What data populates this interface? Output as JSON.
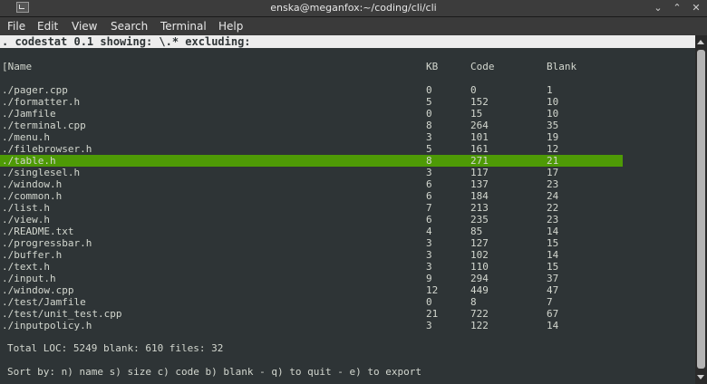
{
  "window": {
    "title": "enska@meganfox:~/coding/cli/cli",
    "minimize_glyph": "⌄",
    "maximize_glyph": "⌃",
    "close_glyph": "✕"
  },
  "menu": [
    "File",
    "Edit",
    "View",
    "Search",
    "Terminal",
    "Help"
  ],
  "status_line": ". codestat 0.1 showing: \\.* excluding:",
  "table": {
    "headers": {
      "name": "[Name",
      "kb": "KB",
      "code": "Code",
      "blank": "Blank"
    },
    "selected_index": 6,
    "rows": [
      {
        "name": "./pager.cpp",
        "kb": "0",
        "code": "0",
        "blank": "1"
      },
      {
        "name": "./formatter.h",
        "kb": "5",
        "code": "152",
        "blank": "10"
      },
      {
        "name": "./Jamfile",
        "kb": "0",
        "code": "15",
        "blank": "10"
      },
      {
        "name": "./terminal.cpp",
        "kb": "8",
        "code": "264",
        "blank": "35"
      },
      {
        "name": "./menu.h",
        "kb": "3",
        "code": "101",
        "blank": "19"
      },
      {
        "name": "./filebrowser.h",
        "kb": "5",
        "code": "161",
        "blank": "12"
      },
      {
        "name": "./table.h",
        "kb": "8",
        "code": "271",
        "blank": "21"
      },
      {
        "name": "./singlesel.h",
        "kb": "3",
        "code": "117",
        "blank": "17"
      },
      {
        "name": "./window.h",
        "kb": "6",
        "code": "137",
        "blank": "23"
      },
      {
        "name": "./common.h",
        "kb": "6",
        "code": "184",
        "blank": "24"
      },
      {
        "name": "./list.h",
        "kb": "7",
        "code": "213",
        "blank": "22"
      },
      {
        "name": "./view.h",
        "kb": "6",
        "code": "235",
        "blank": "23"
      },
      {
        "name": "./README.txt",
        "kb": "4",
        "code": "85",
        "blank": "14"
      },
      {
        "name": "./progressbar.h",
        "kb": "3",
        "code": "127",
        "blank": "15"
      },
      {
        "name": "./buffer.h",
        "kb": "3",
        "code": "102",
        "blank": "14"
      },
      {
        "name": "./text.h",
        "kb": "3",
        "code": "110",
        "blank": "15"
      },
      {
        "name": "./input.h",
        "kb": "9",
        "code": "294",
        "blank": "37"
      },
      {
        "name": "./window.cpp",
        "kb": "12",
        "code": "449",
        "blank": "47"
      },
      {
        "name": "./test/Jamfile",
        "kb": "0",
        "code": "8",
        "blank": "7"
      },
      {
        "name": "./test/unit_test.cpp",
        "kb": "21",
        "code": "722",
        "blank": "67"
      },
      {
        "name": "./inputpolicy.h",
        "kb": "3",
        "code": "122",
        "blank": "14"
      }
    ]
  },
  "totals": "Total LOC: 5249 blank: 610 files: 32",
  "sort_help": "Sort by: n) name s) size c) code b) blank - q) to quit - e) to export",
  "colors": {
    "selected_row": "#4e9a06",
    "terminal_bg": "#2e3436",
    "text": "#d3d7cf"
  }
}
